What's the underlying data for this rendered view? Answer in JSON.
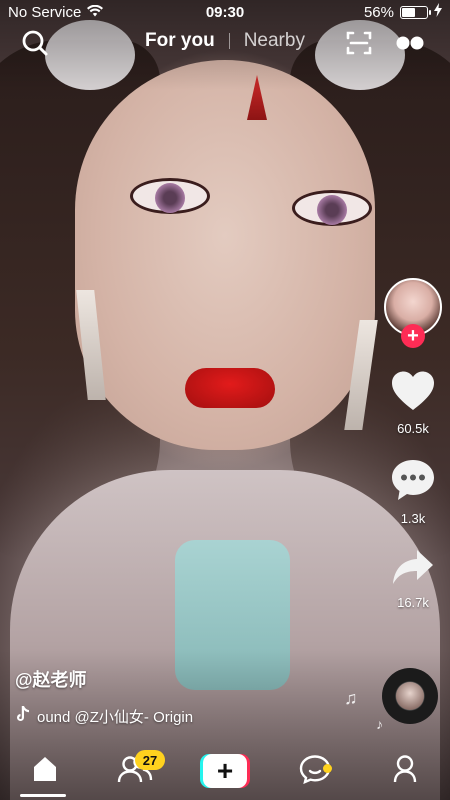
{
  "status_bar": {
    "carrier": "No Service",
    "time": "09:30",
    "battery_percent": "56%",
    "battery_level": 0.56
  },
  "top_nav": {
    "tabs": [
      {
        "label": "For you",
        "active": true
      },
      {
        "label": "Nearby",
        "active": false
      }
    ],
    "icons": [
      "search-icon",
      "scan-icon",
      "more-icon"
    ]
  },
  "video": {
    "author": "@赵老师",
    "sound_text": "ound      @Z小仙女- Origin"
  },
  "actions": {
    "likes": "60.5k",
    "comments": "1.3k",
    "shares": "16.7k"
  },
  "bottom_nav": {
    "friends_badge": "27",
    "create_label": "+"
  },
  "colors": {
    "accent_red": "#fe2c55",
    "accent_cyan": "#25f4ee",
    "badge_yellow": "#ffd21e"
  }
}
